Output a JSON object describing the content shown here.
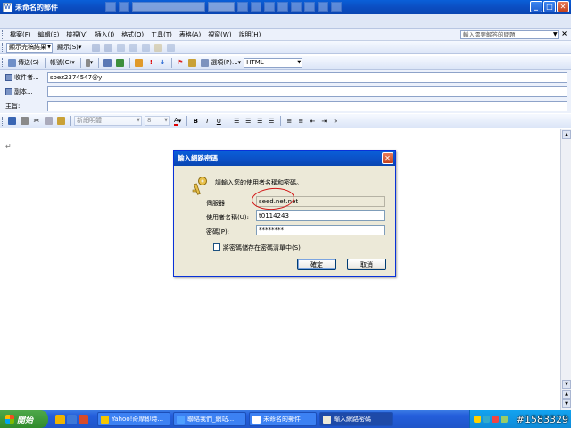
{
  "window": {
    "title": "未命名的郵件"
  },
  "menu": {
    "items": [
      "檔案(F)",
      "編輯(E)",
      "檢視(V)",
      "插入(I)",
      "格式(O)",
      "工具(T)",
      "表格(A)",
      "視窗(W)",
      "說明(H)"
    ],
    "help_placeholder": "輸入需要解答的問題"
  },
  "toolbar2": {
    "view_combo": "顯示完稿結果",
    "show_label": "顯示(S)"
  },
  "mailbar": {
    "send": "傳送(S)",
    "account": "帳號(C)",
    "options": "選項(P)...",
    "format": "HTML"
  },
  "fields": {
    "to_label": "收件者...",
    "to_value": "soez2374547@y",
    "cc_label": "副本...",
    "cc_value": "",
    "subject_label": "主旨:",
    "subject_value": ""
  },
  "formatbar": {
    "font": "新細明體",
    "size": "8"
  },
  "editor": {
    "paragraph_mark": "↵"
  },
  "dialog": {
    "title": "輸入網路密碼",
    "prompt": "請輸入您的使用者名稱和密碼。",
    "server_label": "伺服器",
    "server_value": "seed.net.net",
    "username_label": "使用者名稱(U):",
    "username_value": "t0114243",
    "password_label": "密碼(P):",
    "password_value": "********",
    "save_label": "將密碼儲存在密碼清單中(S)",
    "ok": "確定",
    "cancel": "取消"
  },
  "taskbar": {
    "start": "開始",
    "tasks": [
      "Yahoo!奇摩即時...",
      "聯絡我們_網站...",
      "未命名的郵件",
      "輸入網路密碼"
    ]
  },
  "watermark": "#1583329",
  "colors": {
    "titlebar": "#0a46b2",
    "taskbar": "#245edb",
    "dialog_bg": "#ece9d8",
    "annotation": "#d21414"
  }
}
